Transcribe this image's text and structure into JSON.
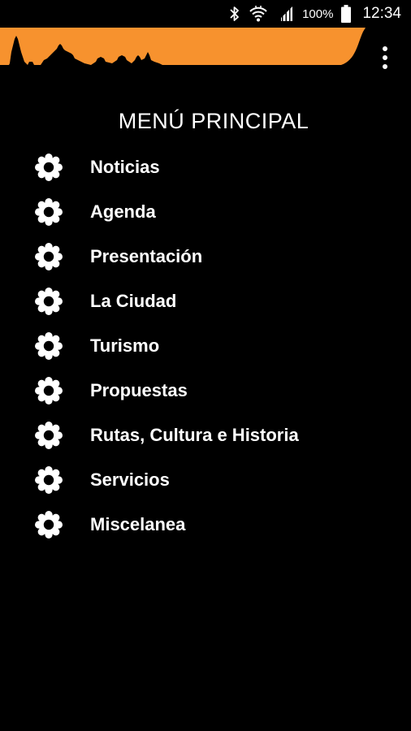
{
  "status_bar": {
    "battery_percent": "100%",
    "time": "12:34",
    "icons": [
      "bluetooth-icon",
      "wifi-icon",
      "signal-icon",
      "battery-icon"
    ]
  },
  "header": {
    "banner_color": "#F7922E",
    "overflow_icon": "more-vertical-icon"
  },
  "menu": {
    "title": "MENÚ PRINCIPAL",
    "item_icon": "gear-icon",
    "items": [
      {
        "label": "Noticias"
      },
      {
        "label": "Agenda"
      },
      {
        "label": "Presentación"
      },
      {
        "label": "La Ciudad"
      },
      {
        "label": "Turismo"
      },
      {
        "label": "Propuestas"
      },
      {
        "label": "Rutas, Cultura e Historia"
      },
      {
        "label": "Servicios"
      },
      {
        "label": "Miscelanea"
      }
    ]
  }
}
